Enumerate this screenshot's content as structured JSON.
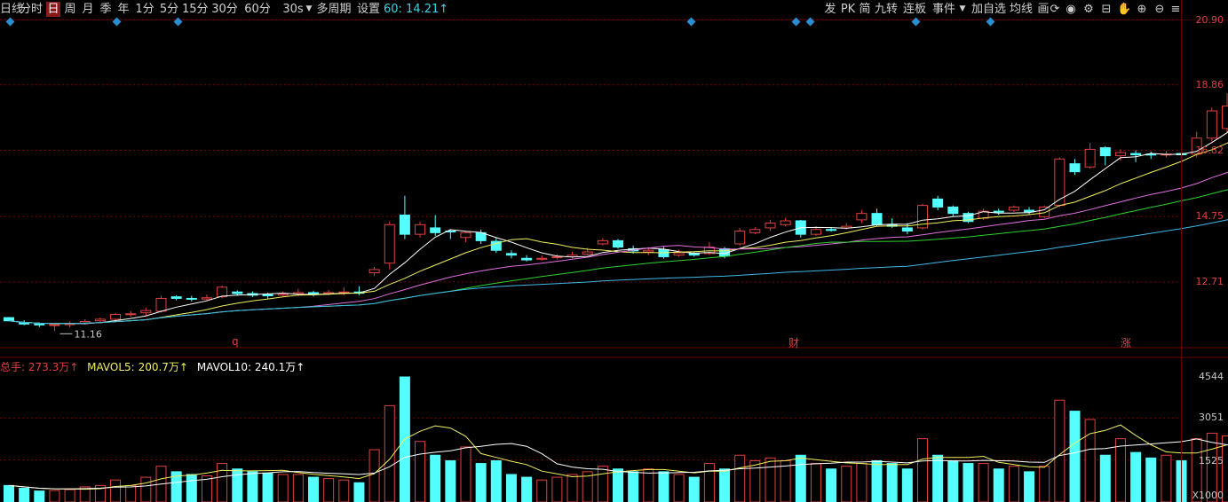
{
  "toolbar": {
    "items": [
      "日线",
      "分时",
      "日",
      "周",
      "月",
      "季",
      "年",
      "1分",
      "5分",
      "15分",
      "30分",
      "60分",
      "30s",
      "多周期",
      "设置"
    ],
    "active": "日",
    "ma_readout": "60: 14.21",
    "ma_arrow": "↑",
    "right_items": [
      "发",
      "PK",
      "简",
      "九转",
      "连板",
      "事件",
      "加自选",
      "均线",
      "画"
    ]
  },
  "price_axis": {
    "labels": [
      "20.90",
      "18.86",
      "16.82",
      "14.75",
      "12.71"
    ],
    "max_price": "20.39",
    "min_price": "11.16"
  },
  "volume_axis": {
    "labels": [
      "4544",
      "3051",
      "1525"
    ],
    "unit": "X1000"
  },
  "volume_legend": {
    "total_label": "总手:",
    "total_value": "273.3万",
    "mavol5_label": "MAVOL5:",
    "mavol5_value": "200.7万",
    "mavol10_label": "MAVOL10:",
    "mavol10_value": "240.1万",
    "arrow": "↑"
  },
  "markers": {
    "q": "q",
    "cai": "财",
    "zhang": "涨"
  },
  "colors": {
    "up": "#e04040",
    "down": "#54ffff",
    "ma5": "#ffffff",
    "ma10": "#f0f060",
    "ma20": "#e070e0",
    "ma30": "#30d030",
    "ma60": "#3fb8e8",
    "grid": "#7a0000"
  }
}
